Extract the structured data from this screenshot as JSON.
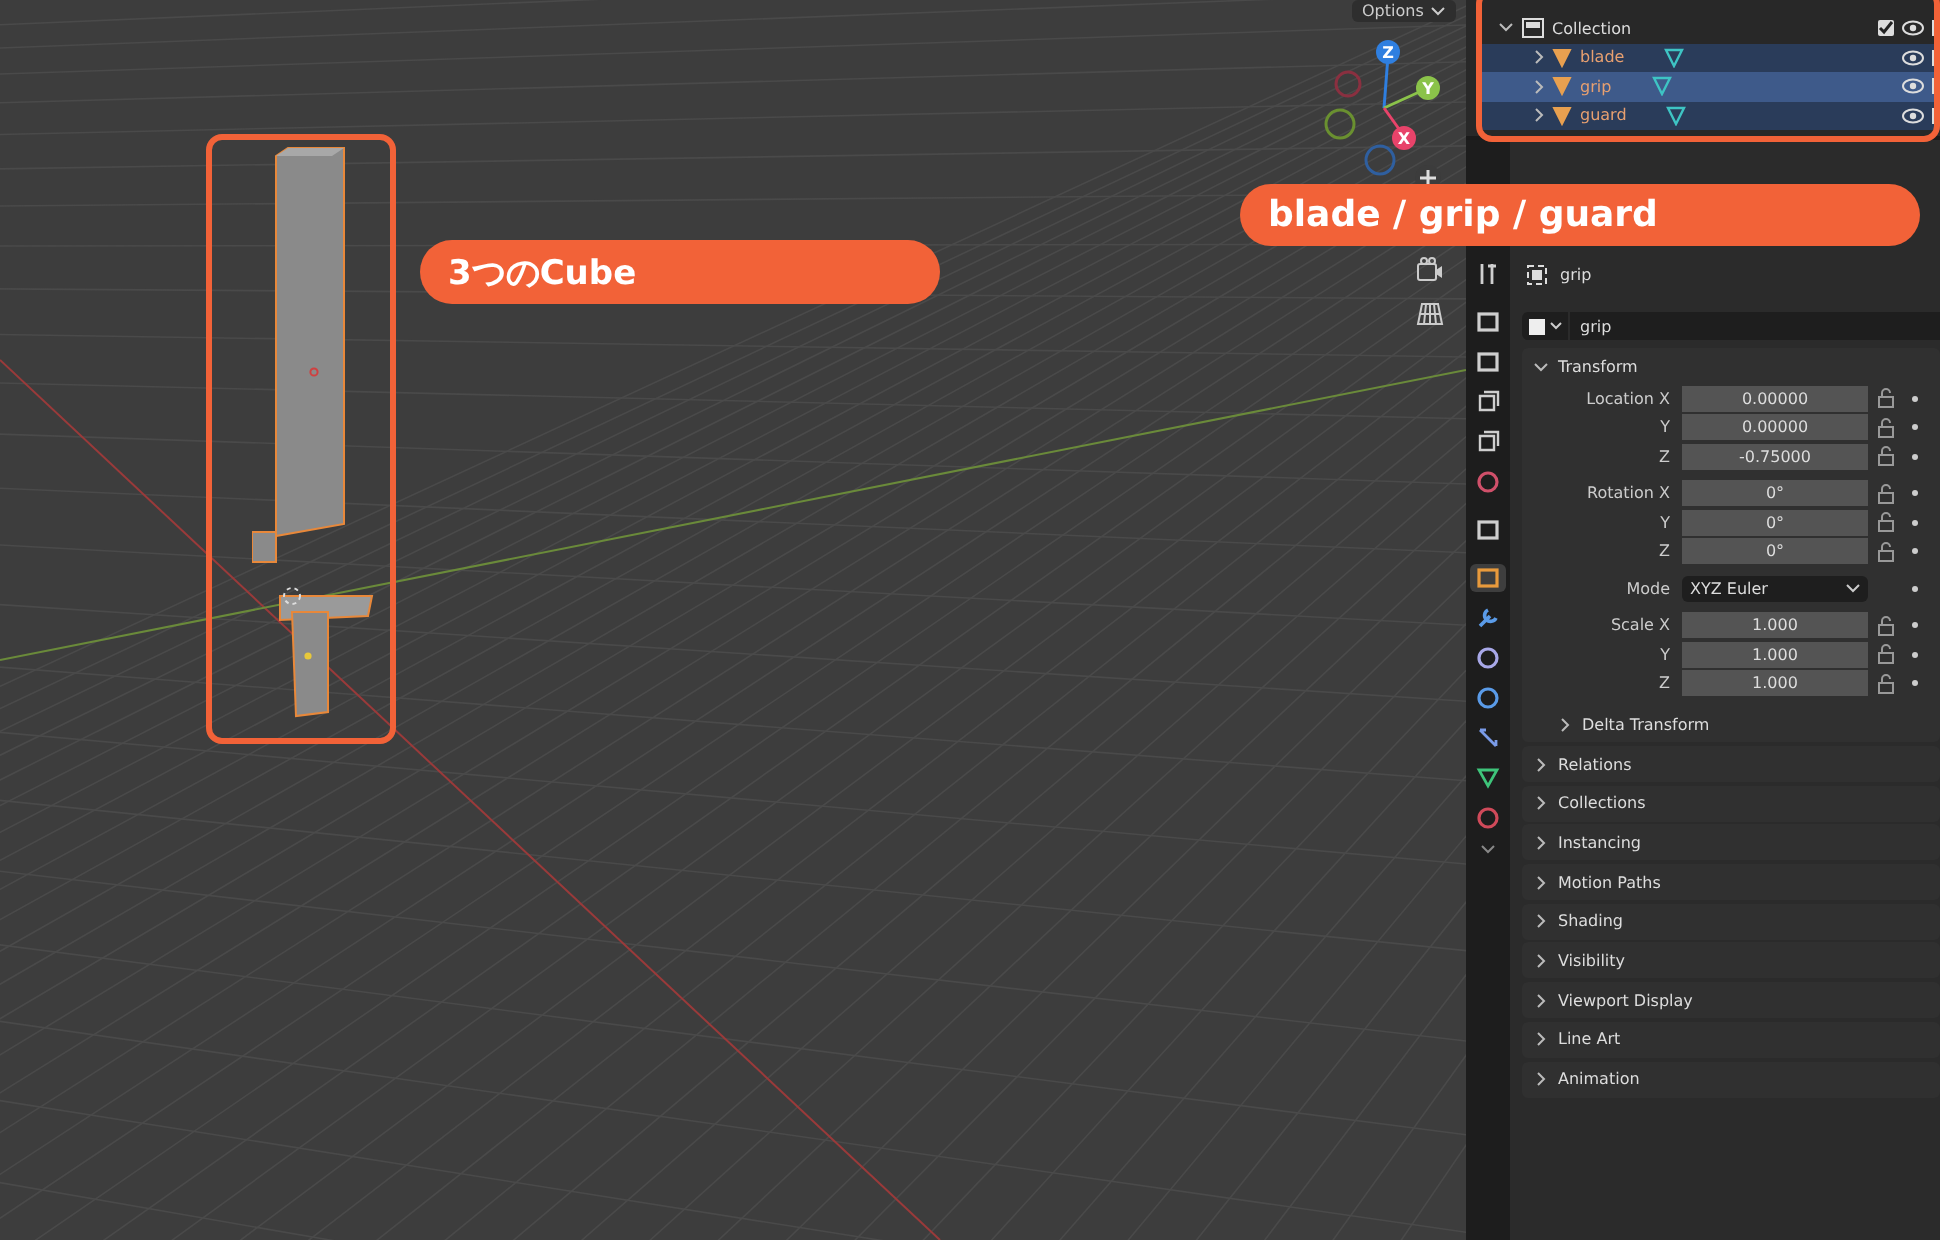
{
  "viewport": {
    "options_button": "Options",
    "gizmo_axes": [
      {
        "label": "Z",
        "color": "#2f7fe0"
      },
      {
        "label": "Y",
        "color": "#8bc34a"
      },
      {
        "label": "X",
        "color": "#e8436a"
      }
    ],
    "annotations": [
      {
        "kind": "object",
        "text": "3つのCube"
      },
      {
        "kind": "outliner",
        "text": "blade / grip / guard"
      }
    ]
  },
  "outliner": {
    "label": "Collection",
    "expanded": true,
    "checked": true,
    "children": [
      {
        "label": "blade",
        "selected": false
      },
      {
        "label": "grip",
        "selected": true
      },
      {
        "label": "guard",
        "selected": false
      }
    ]
  },
  "properties": {
    "tabs": [
      {
        "kind": "tool",
        "selected": false
      },
      {
        "kind": "render",
        "selected": false
      },
      {
        "kind": "output",
        "selected": false
      },
      {
        "kind": "view_layer",
        "selected": false
      },
      {
        "kind": "scene",
        "selected": false
      },
      {
        "kind": "world",
        "selected": false
      },
      {
        "kind": "collection",
        "selected": false
      },
      {
        "kind": "object",
        "selected": true
      },
      {
        "kind": "modifier",
        "selected": false
      },
      {
        "kind": "particles",
        "selected": false
      },
      {
        "kind": "physics",
        "selected": false
      },
      {
        "kind": "constraints",
        "selected": false
      },
      {
        "kind": "data",
        "selected": false
      },
      {
        "kind": "material",
        "selected": false
      }
    ],
    "object_name": "grip",
    "name_field": "grip",
    "transform": {
      "title": "Transform",
      "expanded": true,
      "groups": [
        [
          {
            "label": "Location X",
            "value": "0.00000"
          },
          {
            "label": "Y",
            "value": "0.00000"
          },
          {
            "label": "Z",
            "value": "-0.75000"
          }
        ],
        [
          {
            "label": "Rotation X",
            "value": "0°"
          },
          {
            "label": "Y",
            "value": "0°"
          },
          {
            "label": "Z",
            "value": "0°"
          }
        ],
        [
          {
            "label": "Mode",
            "value": "XYZ Euler",
            "kind": "dropdown"
          }
        ],
        [
          {
            "label": "Scale X",
            "value": "1.000"
          },
          {
            "label": "Y",
            "value": "1.000"
          },
          {
            "label": "Z",
            "value": "1.000"
          }
        ]
      ],
      "delta": {
        "title": "Delta Transform",
        "expanded": false
      }
    },
    "panels": [
      {
        "title": "Relations",
        "expanded": false
      },
      {
        "title": "Collections",
        "expanded": false
      },
      {
        "title": "Instancing",
        "expanded": false
      },
      {
        "title": "Motion Paths",
        "expanded": false
      },
      {
        "title": "Shading",
        "expanded": false
      },
      {
        "title": "Visibility",
        "expanded": false
      },
      {
        "title": "Viewport Display",
        "expanded": false
      },
      {
        "title": "Line Art",
        "expanded": false
      },
      {
        "title": "Animation",
        "expanded": false
      }
    ]
  }
}
